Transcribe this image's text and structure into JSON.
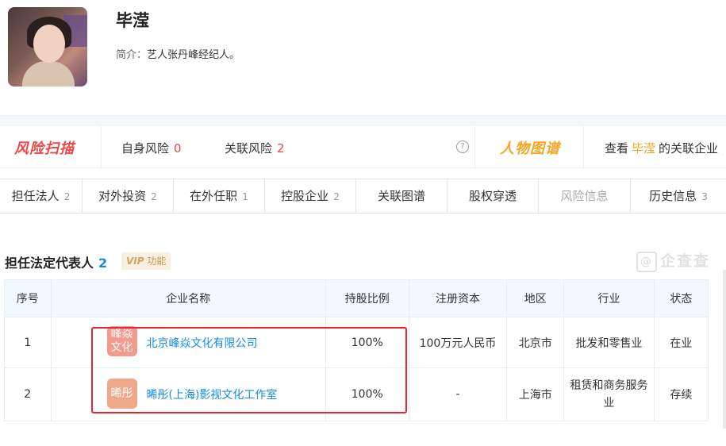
{
  "profile": {
    "name": "毕滢",
    "intro_label": "简介：",
    "intro_text": "艺人张丹峰经纪人。"
  },
  "scan": {
    "logo": "风险扫描",
    "self_risk_label": "自身风险",
    "self_risk_count": "0",
    "related_risk_label": "关联风险",
    "related_risk_count": "2",
    "help": "?",
    "graph_logo": "人物图谱",
    "view_prefix": "查看",
    "view_name": "毕滢",
    "view_suffix": "的关联企业"
  },
  "tabs": [
    {
      "label": "担任法人",
      "count": "2"
    },
    {
      "label": "对外投资",
      "count": "2"
    },
    {
      "label": "在外任职",
      "count": "1"
    },
    {
      "label": "控股企业",
      "count": "2"
    },
    {
      "label": "关联图谱",
      "count": ""
    },
    {
      "label": "股权穿透",
      "count": ""
    },
    {
      "label": "风险信息",
      "count": ""
    },
    {
      "label": "历史信息",
      "count": "3"
    }
  ],
  "section": {
    "title": "担任法定代表人",
    "count": "2",
    "vip_badge": "VIP",
    "vip_text": "功能",
    "watermark": "企查查"
  },
  "table": {
    "headers": [
      "序号",
      "企业名称",
      "持股比例",
      "注册资本",
      "地区",
      "行业",
      "状态"
    ],
    "rows": [
      {
        "index": "1",
        "badge": "峰焱文化",
        "badge_color": "#f29a8e",
        "company": "北京峰焱文化有限公司",
        "share": "100%",
        "capital": "100万元人民币",
        "region": "北京市",
        "industry": "批发和零售业",
        "status": "在业"
      },
      {
        "index": "2",
        "badge": "晞彤",
        "badge_color": "#eda989",
        "company": "晞彤(上海)影视文化工作室",
        "share": "100%",
        "capital": "-",
        "region": "上海市",
        "industry": "租赁和商务服务业",
        "status": "存续"
      }
    ]
  },
  "colors": {
    "risk_red": "#f04646",
    "link_blue": "#128bed",
    "status_green": "#14a086",
    "graph_orange": "#f5a623",
    "highlight_box": "#e9262e"
  }
}
